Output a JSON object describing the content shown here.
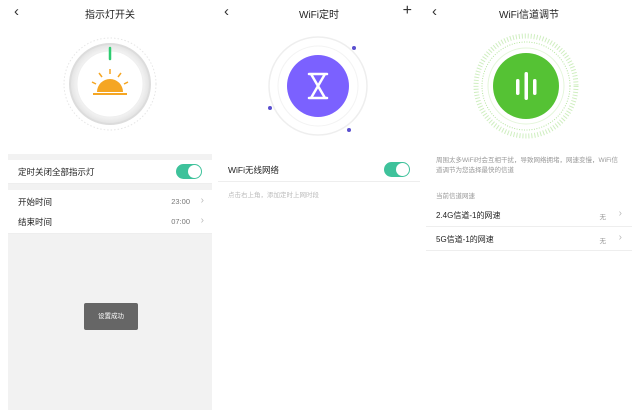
{
  "screen1": {
    "title": "指示灯开关",
    "rows": [
      {
        "label": "定时关闭全部指示灯"
      },
      {
        "label": "开始时间",
        "value": "23:00"
      },
      {
        "label": "结束时间",
        "value": "07:00"
      }
    ],
    "toast": "设置成功",
    "colors": {
      "accent": "#3ec29b",
      "sun": "#f5a623",
      "indicator": "#2ecc71"
    }
  },
  "screen2": {
    "title": "WiFi定时",
    "add_icon": "plus-icon",
    "row_label": "WiFi无线网络",
    "hint": "点击右上角，添加定时上网时段",
    "colors": {
      "circle": "#7b61ff",
      "dot": "#5a4fcf"
    }
  },
  "screen3": {
    "title": "WiFi信道调节",
    "description": "周围太多WiFi时会互相干扰，导致网络拥堵，网速变慢，WiFi信道调节为您选择最快的信道",
    "section_label": "当前信道网速",
    "rows": [
      {
        "label": "2.4G信道-1的网速",
        "value": "无"
      },
      {
        "label": "5G信道-1的网速",
        "value": "无"
      }
    ],
    "colors": {
      "circle": "#55c234",
      "ring": "#b6e6a0"
    }
  }
}
